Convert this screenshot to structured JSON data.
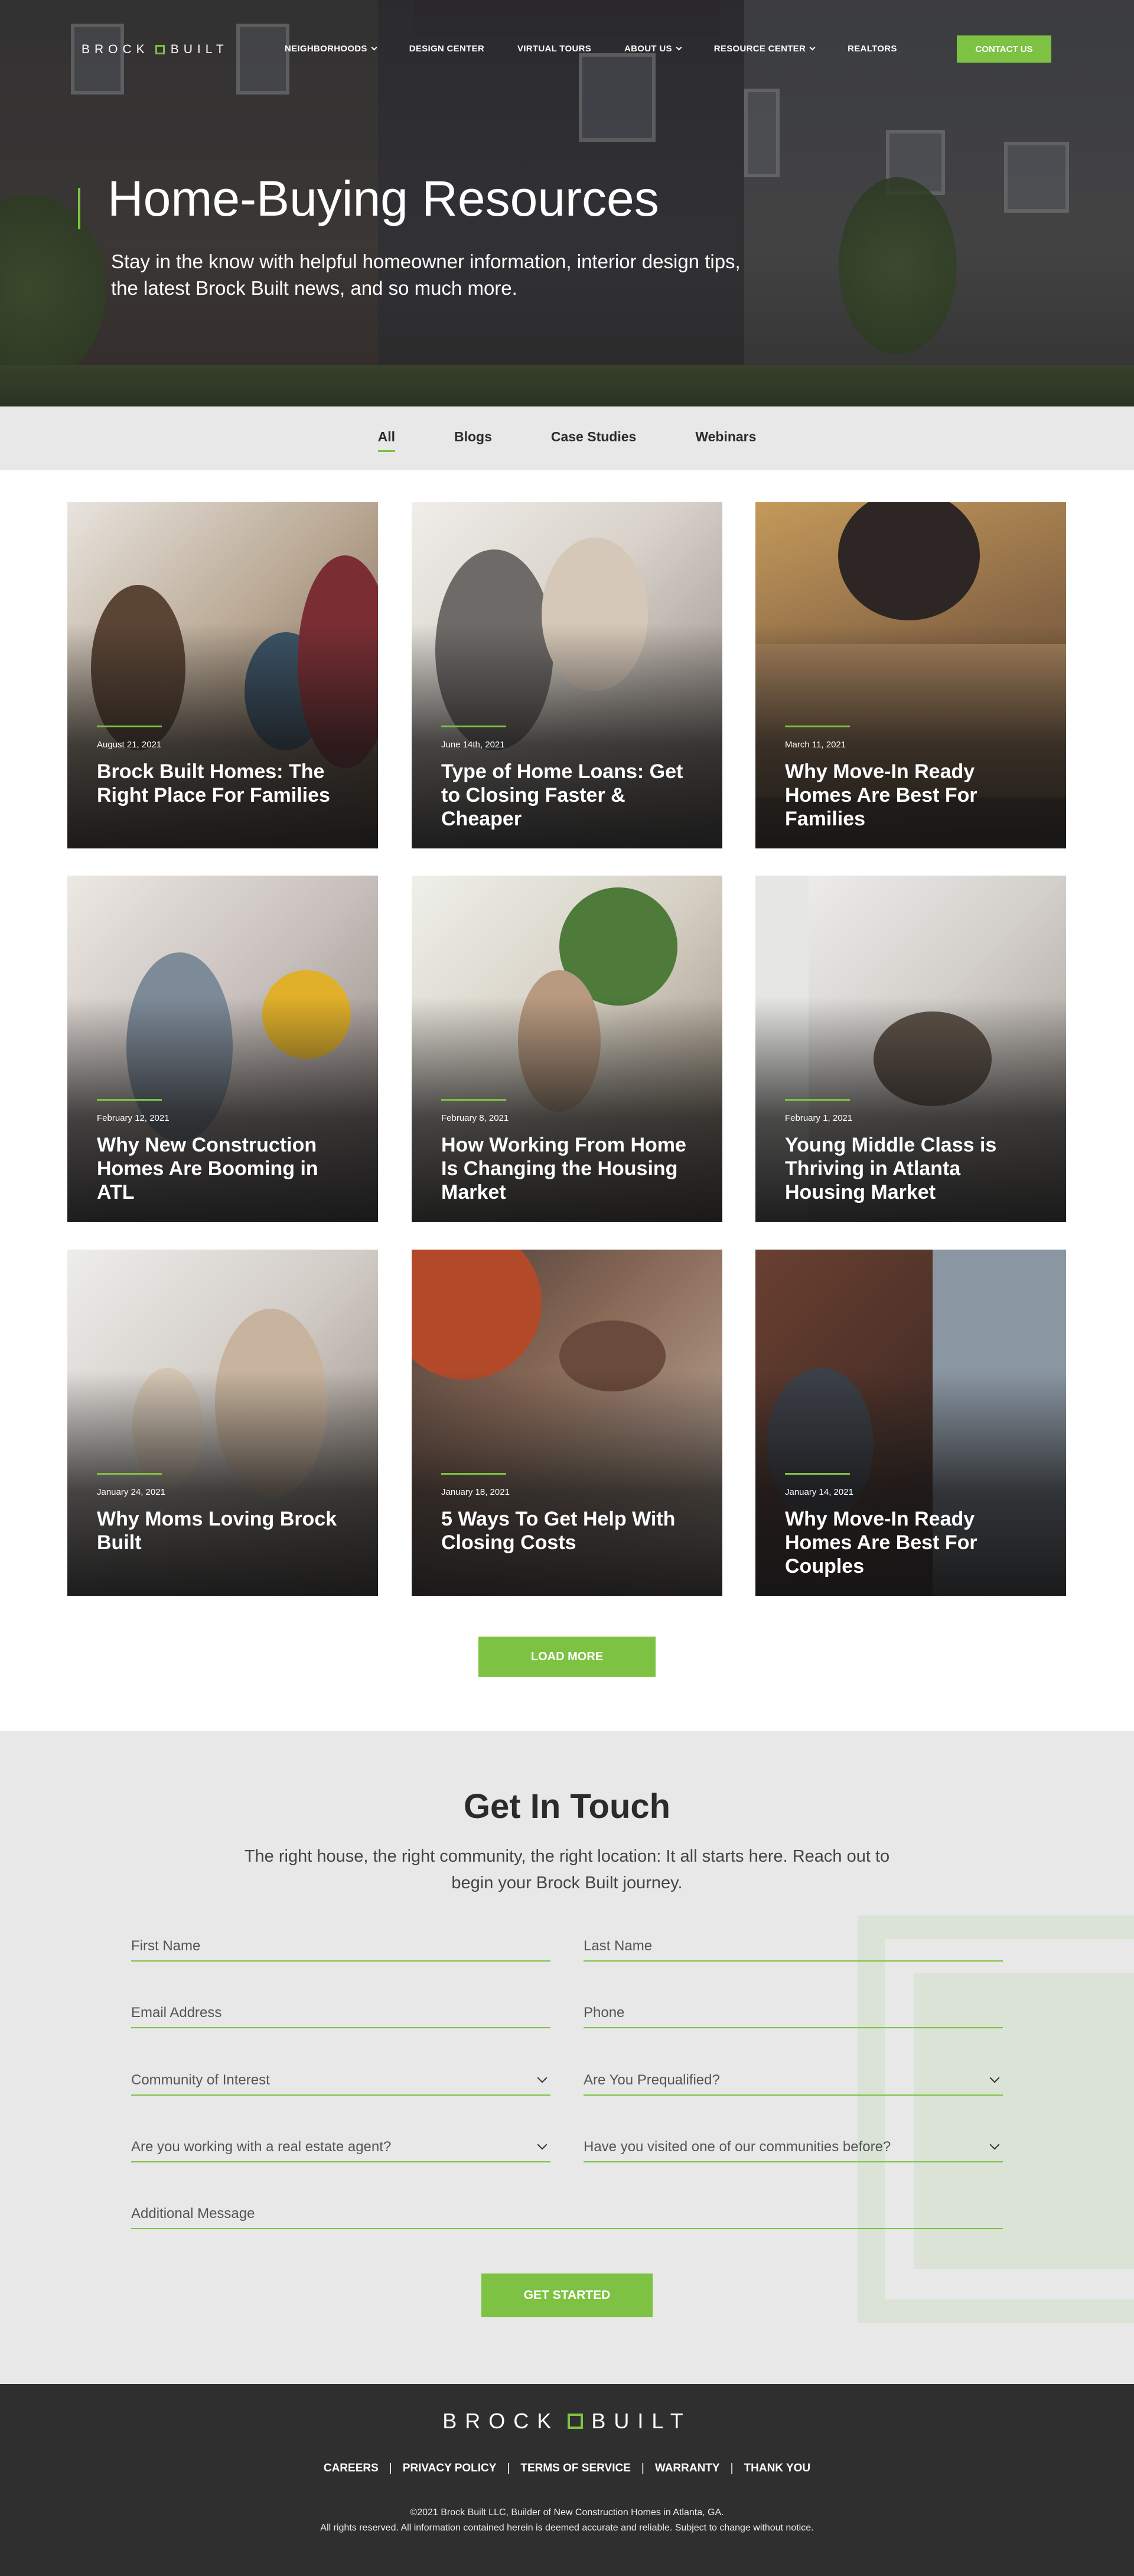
{
  "brand": {
    "logo_left": "BROCK",
    "logo_right": "BUILT",
    "accent_color": "#7dc242"
  },
  "nav": {
    "items": [
      {
        "label": "NEIGHBORHOODS",
        "dropdown": true
      },
      {
        "label": "DESIGN CENTER",
        "dropdown": false
      },
      {
        "label": "VIRTUAL TOURS",
        "dropdown": false
      },
      {
        "label": "ABOUT US",
        "dropdown": true
      },
      {
        "label": "RESOURCE CENTER",
        "dropdown": true
      },
      {
        "label": "REALTORS",
        "dropdown": false
      }
    ],
    "contact_label": "CONTACT US"
  },
  "hero": {
    "title": "Home-Buying Resources",
    "subtitle": "Stay in the know with helpful homeowner information, interior design tips, the latest Brock Built news, and so much more."
  },
  "filters": {
    "tabs": [
      {
        "label": "All",
        "active": true
      },
      {
        "label": "Blogs",
        "active": false
      },
      {
        "label": "Case Studies",
        "active": false
      },
      {
        "label": "Webinars",
        "active": false
      }
    ]
  },
  "cards": [
    {
      "date": "August 21, 2021",
      "title": "Brock Built Homes: The Right Place For Families"
    },
    {
      "date": "June 14th, 2021",
      "title": "Type of Home Loans: Get to Closing Faster & Cheaper"
    },
    {
      "date": "March 11, 2021",
      "title": "Why Move-In Ready Homes Are Best For Families"
    },
    {
      "date": "February 12, 2021",
      "title": "Why New Construction Homes Are Booming in ATL"
    },
    {
      "date": "February 8, 2021",
      "title": "How Working From Home Is Changing the Housing Market"
    },
    {
      "date": "February 1, 2021",
      "title": "Young Middle Class is Thriving in Atlanta Housing Market"
    },
    {
      "date": "January 24, 2021",
      "title": "Why Moms Loving Brock Built"
    },
    {
      "date": "January 18, 2021",
      "title": "5 Ways To Get Help With Closing Costs"
    },
    {
      "date": "January 14, 2021",
      "title": "Why Move-In Ready Homes Are Best For Couples"
    }
  ],
  "load_more_label": "LOAD MORE",
  "contact_form": {
    "title": "Get In Touch",
    "subtitle": "The right house, the right community, the right location: It all starts here. Reach out to begin your Brock Built journey.",
    "fields": {
      "first_name": "First Name",
      "last_name": "Last Name",
      "email": "Email Address",
      "phone": "Phone",
      "community": "Community of Interest",
      "prequalified": "Are You Prequalified?",
      "agent": "Are you working with a real estate agent?",
      "visited": "Have you visited one of our communities before?",
      "message": "Additional Message"
    },
    "submit_label": "GET STARTED"
  },
  "footer": {
    "links": [
      "CAREERS",
      "PRIVACY POLICY",
      "TERMS OF SERVICE",
      "WARRANTY",
      "THANK YOU"
    ],
    "separator": "|",
    "copyright_line1": "©2021 Brock Built LLC, Builder of New Construction Homes in Atlanta, GA.",
    "copyright_line2": "All rights reserved. All information contained herein is deemed accurate and reliable. Subject to change without notice."
  }
}
